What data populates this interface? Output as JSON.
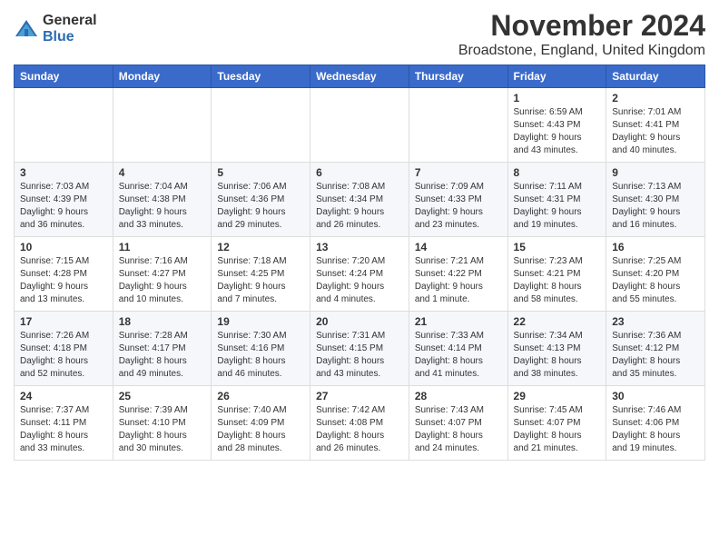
{
  "logo": {
    "general": "General",
    "blue": "Blue"
  },
  "title": {
    "month": "November 2024",
    "location": "Broadstone, England, United Kingdom"
  },
  "headers": [
    "Sunday",
    "Monday",
    "Tuesday",
    "Wednesday",
    "Thursday",
    "Friday",
    "Saturday"
  ],
  "weeks": [
    [
      {
        "day": "",
        "info": ""
      },
      {
        "day": "",
        "info": ""
      },
      {
        "day": "",
        "info": ""
      },
      {
        "day": "",
        "info": ""
      },
      {
        "day": "",
        "info": ""
      },
      {
        "day": "1",
        "info": "Sunrise: 6:59 AM\nSunset: 4:43 PM\nDaylight: 9 hours\nand 43 minutes."
      },
      {
        "day": "2",
        "info": "Sunrise: 7:01 AM\nSunset: 4:41 PM\nDaylight: 9 hours\nand 40 minutes."
      }
    ],
    [
      {
        "day": "3",
        "info": "Sunrise: 7:03 AM\nSunset: 4:39 PM\nDaylight: 9 hours\nand 36 minutes."
      },
      {
        "day": "4",
        "info": "Sunrise: 7:04 AM\nSunset: 4:38 PM\nDaylight: 9 hours\nand 33 minutes."
      },
      {
        "day": "5",
        "info": "Sunrise: 7:06 AM\nSunset: 4:36 PM\nDaylight: 9 hours\nand 29 minutes."
      },
      {
        "day": "6",
        "info": "Sunrise: 7:08 AM\nSunset: 4:34 PM\nDaylight: 9 hours\nand 26 minutes."
      },
      {
        "day": "7",
        "info": "Sunrise: 7:09 AM\nSunset: 4:33 PM\nDaylight: 9 hours\nand 23 minutes."
      },
      {
        "day": "8",
        "info": "Sunrise: 7:11 AM\nSunset: 4:31 PM\nDaylight: 9 hours\nand 19 minutes."
      },
      {
        "day": "9",
        "info": "Sunrise: 7:13 AM\nSunset: 4:30 PM\nDaylight: 9 hours\nand 16 minutes."
      }
    ],
    [
      {
        "day": "10",
        "info": "Sunrise: 7:15 AM\nSunset: 4:28 PM\nDaylight: 9 hours\nand 13 minutes."
      },
      {
        "day": "11",
        "info": "Sunrise: 7:16 AM\nSunset: 4:27 PM\nDaylight: 9 hours\nand 10 minutes."
      },
      {
        "day": "12",
        "info": "Sunrise: 7:18 AM\nSunset: 4:25 PM\nDaylight: 9 hours\nand 7 minutes."
      },
      {
        "day": "13",
        "info": "Sunrise: 7:20 AM\nSunset: 4:24 PM\nDaylight: 9 hours\nand 4 minutes."
      },
      {
        "day": "14",
        "info": "Sunrise: 7:21 AM\nSunset: 4:22 PM\nDaylight: 9 hours\nand 1 minute."
      },
      {
        "day": "15",
        "info": "Sunrise: 7:23 AM\nSunset: 4:21 PM\nDaylight: 8 hours\nand 58 minutes."
      },
      {
        "day": "16",
        "info": "Sunrise: 7:25 AM\nSunset: 4:20 PM\nDaylight: 8 hours\nand 55 minutes."
      }
    ],
    [
      {
        "day": "17",
        "info": "Sunrise: 7:26 AM\nSunset: 4:18 PM\nDaylight: 8 hours\nand 52 minutes."
      },
      {
        "day": "18",
        "info": "Sunrise: 7:28 AM\nSunset: 4:17 PM\nDaylight: 8 hours\nand 49 minutes."
      },
      {
        "day": "19",
        "info": "Sunrise: 7:30 AM\nSunset: 4:16 PM\nDaylight: 8 hours\nand 46 minutes."
      },
      {
        "day": "20",
        "info": "Sunrise: 7:31 AM\nSunset: 4:15 PM\nDaylight: 8 hours\nand 43 minutes."
      },
      {
        "day": "21",
        "info": "Sunrise: 7:33 AM\nSunset: 4:14 PM\nDaylight: 8 hours\nand 41 minutes."
      },
      {
        "day": "22",
        "info": "Sunrise: 7:34 AM\nSunset: 4:13 PM\nDaylight: 8 hours\nand 38 minutes."
      },
      {
        "day": "23",
        "info": "Sunrise: 7:36 AM\nSunset: 4:12 PM\nDaylight: 8 hours\nand 35 minutes."
      }
    ],
    [
      {
        "day": "24",
        "info": "Sunrise: 7:37 AM\nSunset: 4:11 PM\nDaylight: 8 hours\nand 33 minutes."
      },
      {
        "day": "25",
        "info": "Sunrise: 7:39 AM\nSunset: 4:10 PM\nDaylight: 8 hours\nand 30 minutes."
      },
      {
        "day": "26",
        "info": "Sunrise: 7:40 AM\nSunset: 4:09 PM\nDaylight: 8 hours\nand 28 minutes."
      },
      {
        "day": "27",
        "info": "Sunrise: 7:42 AM\nSunset: 4:08 PM\nDaylight: 8 hours\nand 26 minutes."
      },
      {
        "day": "28",
        "info": "Sunrise: 7:43 AM\nSunset: 4:07 PM\nDaylight: 8 hours\nand 24 minutes."
      },
      {
        "day": "29",
        "info": "Sunrise: 7:45 AM\nSunset: 4:07 PM\nDaylight: 8 hours\nand 21 minutes."
      },
      {
        "day": "30",
        "info": "Sunrise: 7:46 AM\nSunset: 4:06 PM\nDaylight: 8 hours\nand 19 minutes."
      }
    ]
  ]
}
